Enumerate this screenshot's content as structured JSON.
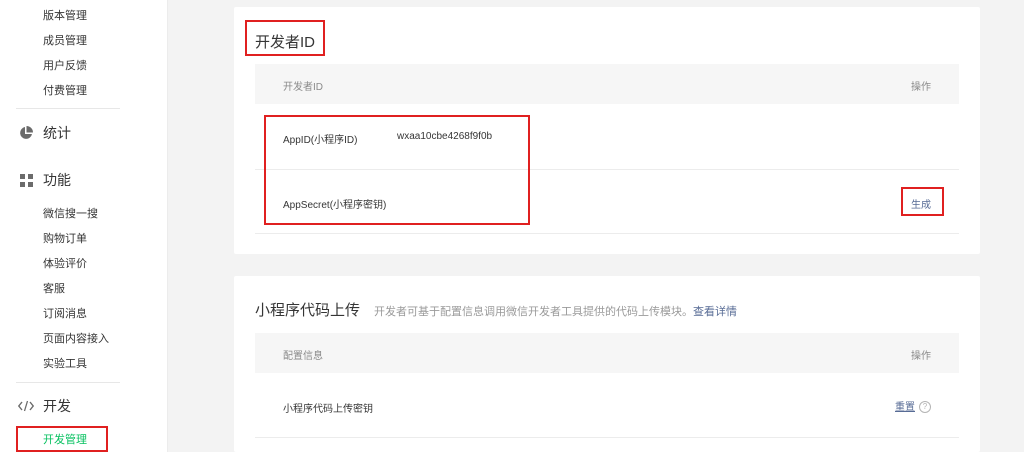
{
  "sidebar": {
    "top_items": [
      "版本管理",
      "成员管理",
      "用户反馈",
      "付费管理"
    ],
    "stats_label": "统计",
    "func_label": "功能",
    "func_items": [
      "微信搜一搜",
      "购物订单",
      "体验评价",
      "客服",
      "订阅消息",
      "页面内容接入",
      "实验工具"
    ],
    "dev_label": "开发",
    "dev_items": [
      "开发管理"
    ]
  },
  "dev_id": {
    "title": "开发者ID",
    "col_left": "开发者ID",
    "col_right": "操作",
    "appid_label": "AppID(小程序ID)",
    "appid_value": "wxaa10cbe4268f9f0b",
    "secret_label": "AppSecret(小程序密钥)",
    "secret_action": "生成"
  },
  "upload": {
    "title": "小程序代码上传",
    "subtitle": "开发者可基于配置信息调用微信开发者工具提供的代码上传模块。",
    "detail_link": "查看详情",
    "col_left": "配置信息",
    "col_right": "操作",
    "key_label": "小程序代码上传密钥",
    "reset_action": "重置",
    "help": "?"
  },
  "colors": {
    "accent_green": "#07c160",
    "link_blue": "#576b95",
    "annotation_red": "#e02020"
  }
}
